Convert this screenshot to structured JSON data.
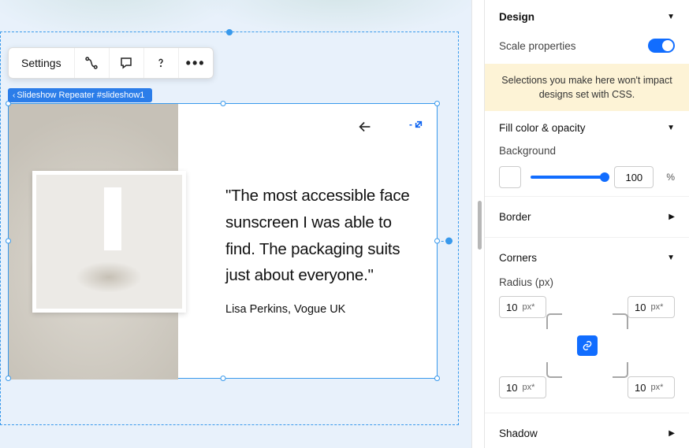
{
  "toolbar": {
    "settings": "Settings"
  },
  "breadcrumb": {
    "label": "Slideshow Repeater #slideshow1"
  },
  "slide": {
    "quote": "\"The most accessible face sunscreen I was able to find. The packaging suits just about everyone.\"",
    "author": "Lisa Perkins, Vogue UK"
  },
  "panel": {
    "design_title": "Design",
    "scale_label": "Scale properties",
    "notice": "Selections you make here won't impact designs set with CSS.",
    "fill_title": "Fill color & opacity",
    "background_label": "Background",
    "opacity_value": "100",
    "opacity_unit": "%",
    "border_title": "Border",
    "corners_title": "Corners",
    "radius_label": "Radius (px)",
    "radius_unit": "px*",
    "radius": {
      "tl": "10",
      "tr": "10",
      "bl": "10",
      "br": "10"
    },
    "shadow_title": "Shadow",
    "colors": {
      "accent": "#116dff",
      "swatch": "#ffffff"
    }
  }
}
